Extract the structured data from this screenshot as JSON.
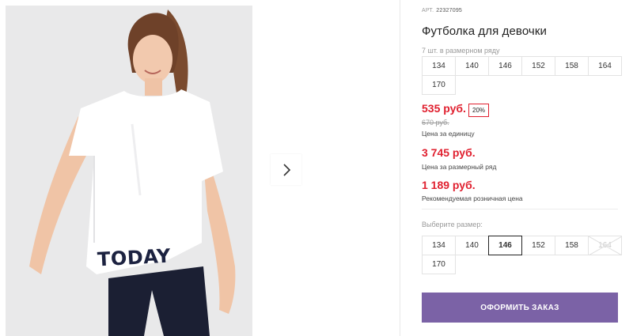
{
  "product": {
    "art_label": "АРТ.",
    "art_number": "22327095",
    "title": "Футболка для девочки",
    "print_text": "TODAY"
  },
  "gallery": {
    "next_icon": "chevron-right-icon"
  },
  "pack": {
    "note": "7 шт. в размерном ряду",
    "sizes": [
      "134",
      "140",
      "146",
      "152",
      "158",
      "164",
      "170"
    ]
  },
  "pricing": {
    "unit_price": "535 руб.",
    "discount": "20%",
    "old_price": "670 руб.",
    "unit_caption": "Цена за единицу",
    "pack_price": "3 745 руб.",
    "pack_caption": "Цена за размерный ряд",
    "retail_price": "1 189 руб.",
    "retail_caption": "Рекомендуемая розничная цена"
  },
  "size_select": {
    "label": "Выберите размер:",
    "sizes": [
      {
        "label": "134",
        "state": "available"
      },
      {
        "label": "140",
        "state": "available"
      },
      {
        "label": "146",
        "state": "selected"
      },
      {
        "label": "152",
        "state": "available"
      },
      {
        "label": "158",
        "state": "available"
      },
      {
        "label": "164",
        "state": "unavailable"
      },
      {
        "label": "170",
        "state": "available"
      }
    ]
  },
  "order_button": {
    "label": "ОФОРМИТЬ ЗАКАЗ"
  },
  "colors": {
    "price_red": "#e0202f",
    "accent_purple": "#7b62a6",
    "photo_bg": "#e9e9ea"
  }
}
